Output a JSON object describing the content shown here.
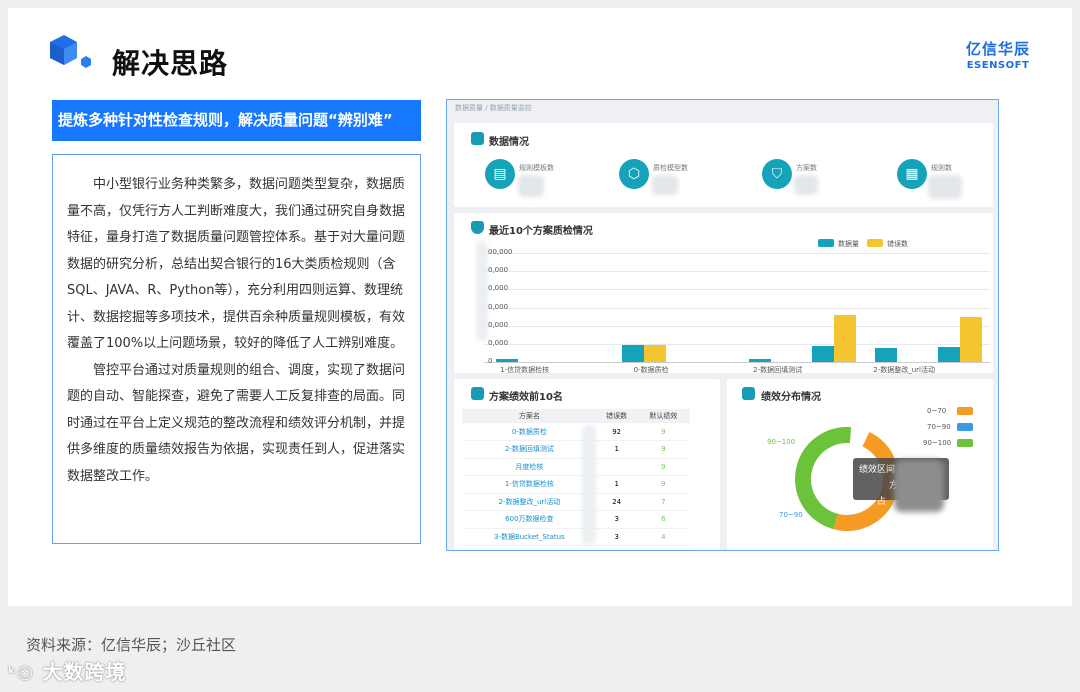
{
  "slide": {
    "title": "解决思路",
    "logo_cn": "亿信华辰",
    "logo_en": "ESENSOFT",
    "banner": "提炼多种针对性检查规则，解决质量问题“辨别难”",
    "paragraphs": [
      "中小型银行业务种类繁多，数据问题类型复杂，数据质量不高，仅凭行方人工判断难度大，我们通过研究自身数据特征，量身打造了数据质量问题管控体系。基于对大量问题数据的研究分析，总结出契合银行的16大类质检规则（含SQL、JAVA、R、Python等），充分利用四则运算、数理统计、数据挖掘等多项技术，提供百余种质量规则模板，有效覆盖了100%以上问题场景，较好的降低了人工辨别难度。",
      "管控平台通过对质量规则的组合、调度，实现了数据问题的自动、智能探查，避免了需要人工反复排查的局面。同时通过在平台上定义规范的整改流程和绩效评分机制，并提供多维度的质量绩效报告为依据，实现责任到人，促进落实数据整改工作。"
    ],
    "source": "资料来源：亿信华辰；沙丘社区",
    "watermark": "大数跨境"
  },
  "dashboard": {
    "breadcrumb": "数据质量 / 数据质量监控",
    "overview": {
      "title": "数据情况",
      "stats": [
        {
          "label": "规则模板数",
          "icon": "table-icon",
          "glyph": "▤"
        },
        {
          "label": "质检模型数",
          "icon": "cube-icon",
          "glyph": "⬡"
        },
        {
          "label": "方案数",
          "icon": "shield-icon",
          "glyph": "⛉"
        },
        {
          "label": "规则数",
          "icon": "file-icon",
          "glyph": "▦"
        }
      ]
    },
    "recent": {
      "title": "最近10个方案质检情况",
      "legend": [
        "数据量",
        "错误数"
      ]
    },
    "ranking": {
      "title": "方案绩效前10名",
      "headers": [
        "方案名",
        "错误数",
        "默认绩效"
      ],
      "rows": [
        {
          "name": "0-数据质检",
          "errors": "92",
          "score": "9"
        },
        {
          "name": "2-数据回填测试",
          "errors": "1",
          "score": "9"
        },
        {
          "name": "月度检核",
          "errors": "",
          "score": "9"
        },
        {
          "name": "1-信贷数据检核",
          "errors": "1",
          "score": "9"
        },
        {
          "name": "2-数据整改_url活动",
          "errors": "24",
          "score": "7"
        },
        {
          "name": "600万数据检查",
          "errors": "3",
          "score": "6"
        },
        {
          "name": "3-数据Bucket_Status",
          "errors": "3",
          "score": "4"
        }
      ]
    },
    "distribution": {
      "title": "绩效分布情况",
      "legend": [
        "0~70",
        "70~90",
        "90~100"
      ],
      "labels": [
        "90~100",
        "70~90"
      ],
      "tooltip": [
        "绩效区间",
        "方",
        "占"
      ]
    }
  },
  "colors": {
    "teal": "#16a3b9",
    "yellow": "#f5c531",
    "orange": "#f59a23",
    "blue": "#3a9ae8",
    "green": "#6cc23a",
    "brand": "#1677ff"
  },
  "chart_data": {
    "type": "bar",
    "title": "最近10个方案质检情况",
    "categories": [
      "1-信贷数据检核",
      "",
      "0-数据质检",
      "",
      "2-数据回填测试",
      "",
      "2-数据整改_url活动",
      ""
    ],
    "series": [
      {
        "name": "数据量",
        "values": [
          15000,
          0,
          95000,
          0,
          15000,
          90000,
          75000,
          85000
        ]
      },
      {
        "name": "错误数",
        "values": [
          0,
          0,
          95000,
          0,
          0,
          260000,
          0,
          250000
        ]
      }
    ],
    "ytick_labels": [
      "00,000",
      "0,000",
      "0,000",
      "0,000",
      "0,000",
      "0,000",
      "0"
    ],
    "ylim": [
      0,
      600000
    ],
    "legend": "top-right",
    "grid": true
  }
}
